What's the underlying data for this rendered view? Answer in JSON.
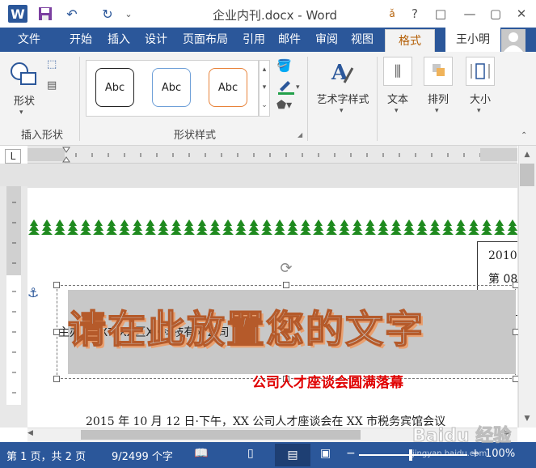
{
  "window": {
    "title": "企业内刊.docx - Word"
  },
  "title_buttons": [
    "?",
    "□",
    "—",
    "▢",
    "✕"
  ],
  "tabs": [
    "文件",
    "开始",
    "插入",
    "设计",
    "页面布局",
    "引用",
    "邮件",
    "审阅",
    "视图",
    "格式"
  ],
  "user": {
    "name": "王小明"
  },
  "ribbon": {
    "insert_shapes": {
      "shape_label": "形状",
      "group_label": "插入形状"
    },
    "shape_styles": {
      "samples": [
        "Abc",
        "Abc",
        "Abc"
      ],
      "group_label": "形状样式"
    },
    "wordart": {
      "label": "艺术字样式"
    },
    "text": {
      "label": "文本"
    },
    "arrange": {
      "label": "排列"
    },
    "size": {
      "label": "大小"
    }
  },
  "ruler": {
    "corner": "L"
  },
  "document": {
    "wordart_text": "请在此放置您的文字",
    "sponsor_text": "主办：XX市XX区XX科技有限公司",
    "subtitle": "公司人才座谈会圆满落幕",
    "body_line": "2015 年 10 月 12 日·下午，XX 公司人才座谈会在 XX 市税务宾馆会议",
    "side_box_line1": "2010",
    "side_box_line2": "第 08"
  },
  "status": {
    "page": "第 1 页，共 2 页",
    "words": "9/2499 个字",
    "zoom": "100%"
  },
  "watermark": {
    "text": "Baidu 经验",
    "url": "jingyan.baidu.com"
  },
  "colors": {
    "accent": "#2b579a",
    "wordart": "#b55a2a",
    "subtitle": "#e00000",
    "format_tab": "#b45f06"
  }
}
